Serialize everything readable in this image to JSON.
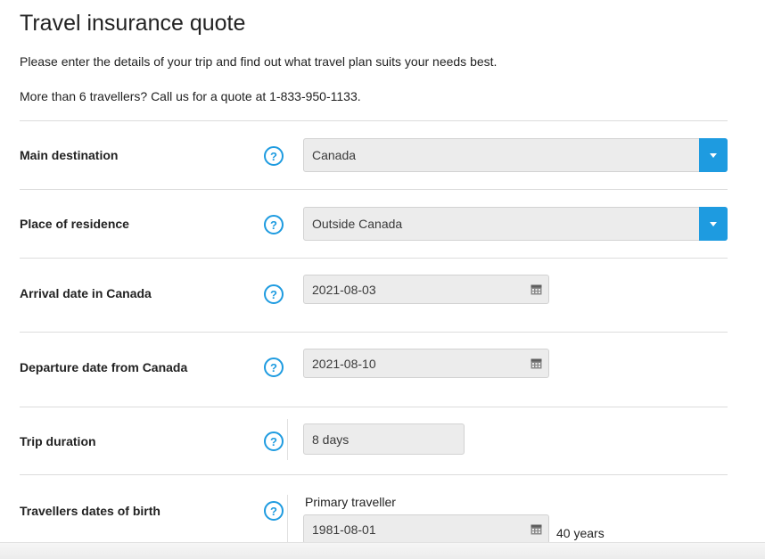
{
  "page": {
    "title": "Travel insurance quote",
    "intro": "Please enter the details of your trip and find out what travel plan suits your needs best.",
    "call_note": "More than 6 travellers? Call us for a quote at 1-833-950-1133."
  },
  "form": {
    "help_glyph": "?",
    "main_destination": {
      "label": "Main destination",
      "value": "Canada"
    },
    "place_of_residence": {
      "label": "Place of residence",
      "value": "Outside Canada"
    },
    "arrival_date": {
      "label": "Arrival date in Canada",
      "value": "2021-08-03"
    },
    "departure_date": {
      "label": "Departure date from Canada",
      "value": "2021-08-10"
    },
    "trip_duration": {
      "label": "Trip duration",
      "value": "8 days"
    },
    "travellers": {
      "label": "Travellers dates of birth",
      "primary_label": "Primary traveller",
      "primary_dob": "1981-08-01",
      "primary_age": "40 years"
    }
  },
  "colors": {
    "accent": "#1e9be0",
    "field_bg": "#ececec",
    "divider": "#dcdcdc"
  },
  "icons": {
    "help": "question-circle-icon",
    "dropdown": "caret-down-icon",
    "calendar": "calendar-icon"
  }
}
